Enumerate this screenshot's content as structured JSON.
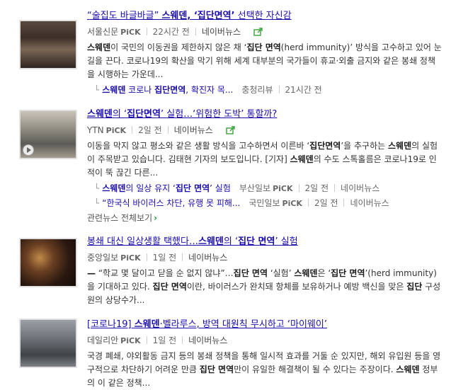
{
  "pick_label": "PiCK",
  "articles": [
    {
      "title_pre": "“술집도 바글바글” ",
      "title_bold": "스웨덴, ‘집단면역’",
      "title_post": " 선택한 자신감",
      "press": "서울신문",
      "time": "22시간 전",
      "naver": "네이버뉴스",
      "desc_html": "<b>스웨덴</b>이 국민의 이동권을 제한하지 않은 채 ‘<b>집단 면역</b>(herd immunity)’ 방식을 고수하고 있어 눈길을 끈다. 코로나19의 확산을 막기 위해 세계 대부분의 국가들이 휴교·외출 금지와 같은 봉쇄 정책을 시행하는 가운데...",
      "related": [
        {
          "title_html": "<b>스웨덴</b> 코로나 <b>집단면역</b>, 확진자 목...",
          "source": "충청리뷰",
          "time": "21시간 전"
        }
      ]
    },
    {
      "title_pre": "",
      "title_bold": "스웨덴",
      "title_post": "의 ‘<b>집단면역</b>’ 실험…‘위험한 도박’ 통할까?",
      "press": "YTN",
      "time": "2일 전",
      "naver": "네이버뉴스",
      "desc_html": "이동을 막지 않고 평소와 같은 생활 방식을 고수하면서 이른바 ‘<b>집단면역</b>’을 추구하는 <b>스웨덴</b>의 실험이 주목받고 있습니다. 김태현 기자의 보도입니다. [기자] <b>스웨덴</b>의 수도 스톡홀름은 코로나19로 인적이 뚝 끊긴 다른...",
      "related": [
        {
          "title_html": "<b>스웨덴</b>의 일상 유지 ‘<b>집단 면역</b>’ 실험",
          "source": "부산일보",
          "time": "2일 전",
          "naver": "네이버뉴스"
        },
        {
          "title_html": "“한국식 바이러스 차단, 유행 못 피해...",
          "source": "국민일보",
          "time": "2일 전",
          "naver": "네이버뉴스"
        }
      ],
      "more": "관련뉴스 전체보기"
    },
    {
      "title_pre": "봉쇄 대신 일상생활 택했다…",
      "title_bold": "스웨덴",
      "title_post": "의 ‘<b>집단 면역</b>’ 실험",
      "press": "중앙일보",
      "time": "1일 전",
      "naver": "네이버뉴스",
      "desc_html": "<b>—</b> “학교 몇 달이고 닫을 순 없지 않냐”…<b>집단 면역</b> ‘실험’ <b>스웨덴</b>은 ‘<b>집단 면역</b>’(herd immunity)을 기대하고 있다. <b>집단 면역</b>이란, 바이러스가 완치돼 항체를 보유하거나 예방 백신을 맞은 <b>집단</b> 구성원의 상당수가...",
      "related": []
    },
    {
      "title_pre": "[코로나19] ",
      "title_bold": "스웨덴",
      "title_post": "·벨라루스, 방역 대원칙 무시하고 ‘마이웨이’",
      "press": "데일리안",
      "time": "1일 전",
      "naver": "네이버뉴스",
      "desc_html": "국경 폐쇄, 야외활동 금지 등의 봉쇄 정책을 통해 일시적 효과를 거둘 순 있지만, 해외 유입원 등을 영구적으로 차단하기 어려운 만큼 <b>집단 면역</b>만이 유일한 해결책이 될 수 있다는 주장이다. <b>스웨덴</b> 정부의 이 같은 정책...",
      "related": []
    }
  ]
}
